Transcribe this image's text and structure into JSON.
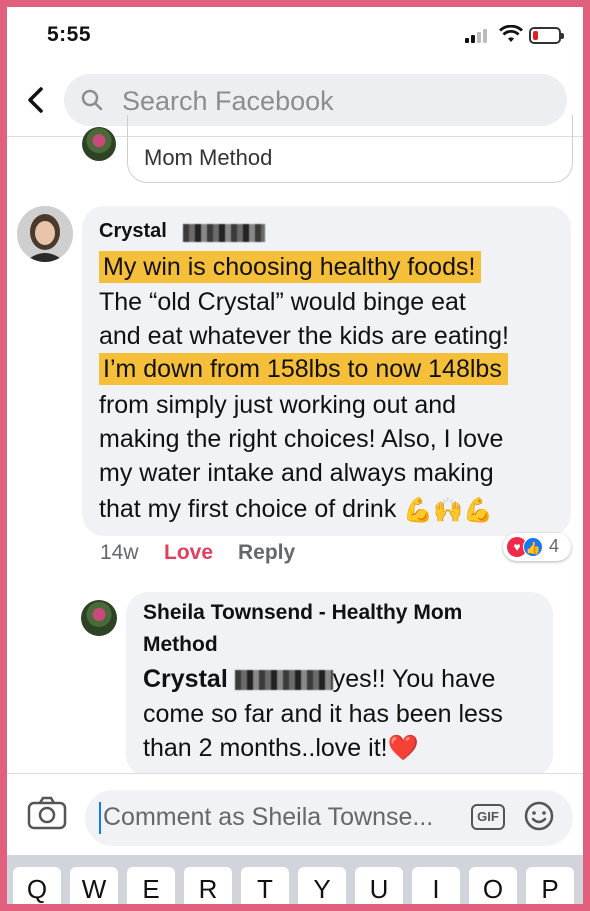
{
  "status_bar": {
    "time": "5:55"
  },
  "search": {
    "placeholder": "Search Facebook"
  },
  "previous_comment": {
    "visible_text": "Mom Method"
  },
  "comment": {
    "author": "Crystal",
    "lines": [
      "My win is choosing healthy foods!",
      "The “old Crystal” would binge eat",
      "and eat whatever the kids are eating!",
      "I’m down from 158lbs to now 148lbs",
      "from simply just working out and",
      "making the right choices! Also, I love",
      "my water intake and always making",
      "that my first choice of drink"
    ],
    "emoji": "💪🙌💪",
    "time": "14w",
    "love_label": "Love",
    "reply_label": "Reply",
    "reaction_count": "4"
  },
  "reply": {
    "author_line1": "Sheila Townsend - Healthy Mom",
    "author_line2": "Method",
    "mention": "Crystal",
    "line1_rest": "yes!! You have",
    "line2": "come so far and it has been less",
    "line3": "than 2 months..love it!",
    "heart": "❤️"
  },
  "composer": {
    "placeholder": "Comment as Sheila Townse...",
    "gif_label": "GIF"
  },
  "keyboard": {
    "keys": [
      "Q",
      "W",
      "E",
      "R",
      "T",
      "Y",
      "U",
      "I",
      "O",
      "P"
    ]
  },
  "colors": {
    "highlight": "#f5bf39",
    "love": "#e0405e",
    "accent": "#1877f2",
    "frame": "#e0607e"
  }
}
